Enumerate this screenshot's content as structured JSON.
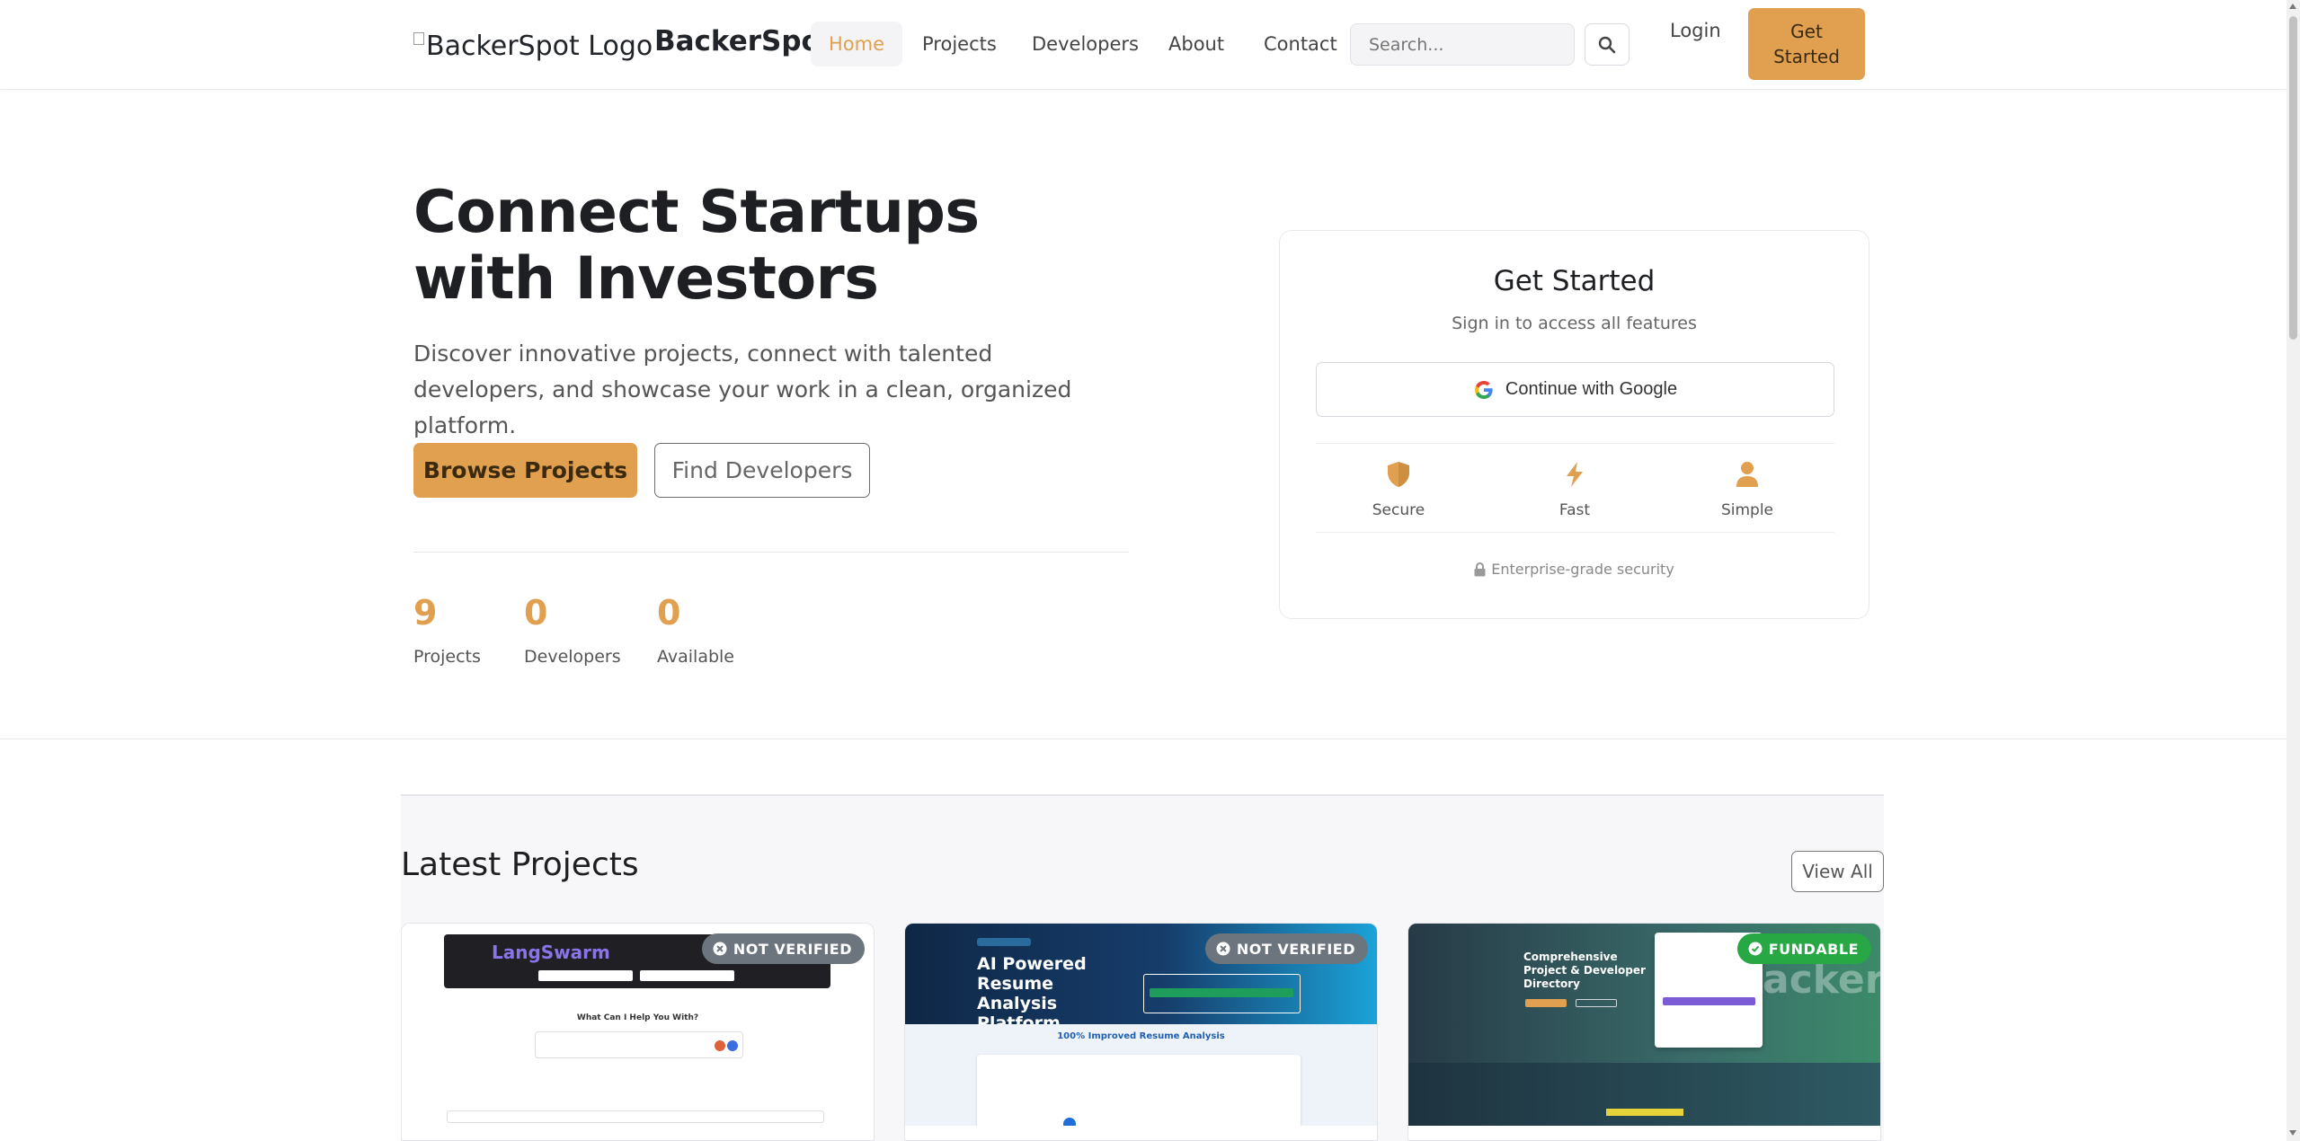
{
  "navbar": {
    "logo_alt": "BackerSpot Logo",
    "brand": "BackerSpot",
    "links": [
      {
        "label": "Home",
        "active": true
      },
      {
        "label": "Projects",
        "active": false
      },
      {
        "label": "Developers",
        "active": false
      },
      {
        "label": "About",
        "active": false
      },
      {
        "label": "Contact",
        "active": false
      }
    ],
    "search_placeholder": "Search...",
    "search_icon": "search-icon",
    "login": "Login",
    "get_started": "Get Started"
  },
  "hero": {
    "title": "Connect Startups with Investors",
    "subtitle": "Discover innovative projects, connect with talented developers, and showcase your work in a clean, organized platform.",
    "primary_button": "Browse Projects",
    "secondary_button": "Find Developers",
    "stats": [
      {
        "value": "9",
        "label": "Projects"
      },
      {
        "value": "0",
        "label": "Developers"
      },
      {
        "value": "0",
        "label": "Available"
      }
    ]
  },
  "auth_card": {
    "title": "Get Started",
    "subtitle": "Sign in to access all features",
    "google_button": "Continue with Google",
    "features": [
      {
        "label": "Secure",
        "icon": "shield-icon"
      },
      {
        "label": "Fast",
        "icon": "bolt-icon"
      },
      {
        "label": "Simple",
        "icon": "user-icon"
      }
    ],
    "footer": "Enterprise-grade security",
    "footer_icon": "lock-icon"
  },
  "latest_projects": {
    "title": "Latest Projects",
    "view_all": "View All",
    "projects": [
      {
        "badge": "NOT VERIFIED",
        "badge_icon": "x-circle-icon",
        "thumb_logo": "LangSwarm",
        "thumb_question": "What Can I Help You With?"
      },
      {
        "badge": "NOT VERIFIED",
        "badge_icon": "x-circle-icon",
        "thumb_title": "AI Powered Resume Analysis Platform",
        "thumb_subtitle": "100% Improved Resume Analysis"
      },
      {
        "badge": "FUNDABLE",
        "badge_icon": "check-circle-icon",
        "thumb_title": "Comprehensive Project & Developer Directory",
        "thumb_watermark": "ackerspot"
      }
    ]
  },
  "colors": {
    "accent": "#e0a050",
    "badge_gray": "#6c757d",
    "badge_green": "#28a745",
    "text_dark": "#1d1f22"
  }
}
